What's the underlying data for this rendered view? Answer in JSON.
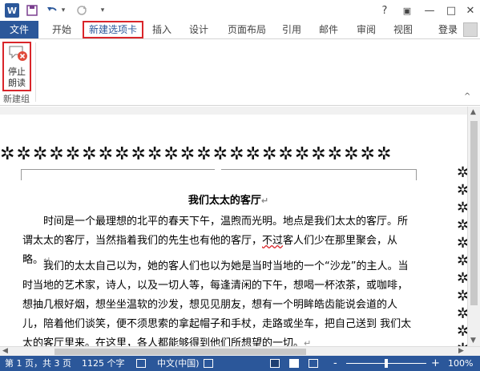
{
  "quick_access": {
    "app_letter": "W",
    "undo_dropdown": "▾",
    "more": "▾"
  },
  "window_controls": {
    "help": "?",
    "ribbon_options": "▣",
    "minimize": "—",
    "restore": "□",
    "close": "✕"
  },
  "tabs": [
    {
      "label": "文件"
    },
    {
      "label": "开始"
    },
    {
      "label": "新建选项卡"
    },
    {
      "label": "插入"
    },
    {
      "label": "设计"
    },
    {
      "label": "页面布局"
    },
    {
      "label": "引用"
    },
    {
      "label": "邮件"
    },
    {
      "label": "审阅"
    },
    {
      "label": "视图"
    }
  ],
  "login_label": "登录",
  "ribbon": {
    "stop_reading_label": "停止\n朗读",
    "group_label": "新建组",
    "collapse": "^"
  },
  "document": {
    "title": "我们太太的客厅",
    "paragraph_mark": "↵",
    "p1_before": "时间是一个最理想的北平的春天下午，温煦而光明。地点是我们太太的客厅。所谓太太的客厅，当然指着我们的先生也有他的客厅，",
    "p1_squiggle": "不过",
    "p1_after": "客人们少在那里聚会，从略。",
    "p2": "我们的太太自己以为，她的客人们也以为她是当时当地的一个“沙龙”的主人。当时当地的艺术家，诗人，以及一切人等，每逢清闲的下午，想喝一杯浓茶，或咖啡，想抽几根好烟，想坐坐温软的沙发，想见见朋友，想有一个明眸皓齿能说会道的人儿，陪着他们谈笑，便不须思索的拿起帽子和手杖，走路或坐车，把自己送到 我们太太的客厅里来。在这里，各人都能够得到他们所想望的一切。"
  },
  "border_glyph": "✲",
  "status": {
    "page": "第 1 页，共 3 页",
    "words": "1125 个字",
    "language": "中文(中国)",
    "zoom": "100%",
    "zoom_minus": "-",
    "zoom_plus": "+",
    "zoom_fraction": 0.5
  },
  "colors": {
    "accent": "#2b579a",
    "highlight": "#d9252a"
  }
}
